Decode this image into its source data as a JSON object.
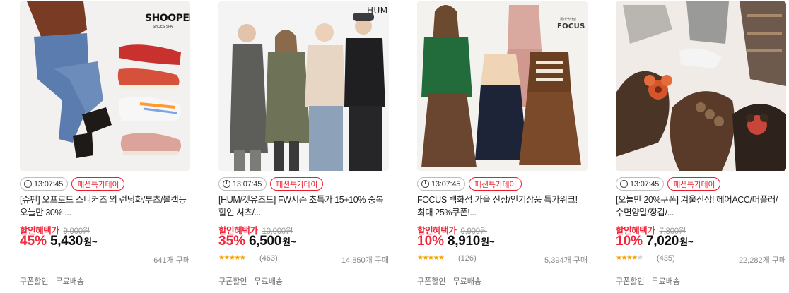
{
  "products": [
    {
      "brand_mark": "SHOOPEN",
      "brand_sub": "SHOES SPA",
      "timer": "13:07:45",
      "event": "패션특가데이",
      "title": "[슈펜] 오프로드 스니커즈 외 런닝화/부츠/볼캡등 오늘만 30% ...",
      "benefit_label": "할인혜택가",
      "original_price": "9,900원",
      "discount": "45%",
      "price": "5,430",
      "price_unit": "원~",
      "rating": null,
      "reviews": "",
      "buy_count": "641개 구매",
      "badges": [
        "쿠폰할인",
        "무료배송"
      ]
    },
    {
      "brand_mark": "HUM",
      "brand_sub": "",
      "timer": "13:07:45",
      "event": "패션특가데이",
      "title": "[HUM/겟유즈드] FW시즌 초특가 15+10% 중복 할인 셔츠/...",
      "benefit_label": "할인혜택가",
      "original_price": "10,000원",
      "discount": "35%",
      "price": "6,500",
      "price_unit": "원~",
      "rating": 4.5,
      "reviews": "(463)",
      "buy_count": "14,850개 구매",
      "badges": [
        "쿠폰할인",
        "무료배송"
      ]
    },
    {
      "brand_mark": "FOCUS",
      "brand_sub": "롯데백화점",
      "timer": "13:07:45",
      "event": "패션특가데이",
      "title": "FOCUS 백화점 가을 신상/인기상품 특가위크! 최대 25%쿠폰!...",
      "benefit_label": "할인혜택가",
      "original_price": "9,900원",
      "discount": "10%",
      "price": "8,910",
      "price_unit": "원~",
      "rating": 4.5,
      "reviews": "(126)",
      "buy_count": "5,394개 구매",
      "badges": [
        "쿠폰할인",
        "무료배송"
      ]
    },
    {
      "brand_mark": "",
      "brand_sub": "",
      "timer": "13:07:45",
      "event": "패션특가데이",
      "title": "[오늘만 20%쿠폰] 겨울신상! 헤어ACC/머플러/수면양말/장갑/...",
      "benefit_label": "할인혜택가",
      "original_price": "7,800원",
      "discount": "10%",
      "price": "7,020",
      "price_unit": "원~",
      "rating": 4,
      "reviews": "(435)",
      "buy_count": "22,282개 구매",
      "badges": [
        "쿠폰할인",
        "무료배송"
      ]
    }
  ],
  "colors": {
    "accent": "#f0263a",
    "star": "#f5a400",
    "muted": "#888888"
  }
}
